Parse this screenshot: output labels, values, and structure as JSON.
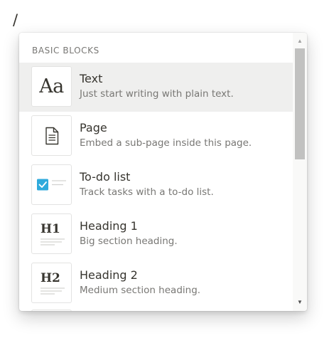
{
  "input": {
    "text": "/"
  },
  "menu": {
    "section_header": "BASIC BLOCKS",
    "items": [
      {
        "icon": "text-icon",
        "thumb": "Aa",
        "title": "Text",
        "description": "Just start writing with plain text.",
        "selected": true
      },
      {
        "icon": "page-icon",
        "title": "Page",
        "description": "Embed a sub-page inside this page.",
        "selected": false
      },
      {
        "icon": "todo-checkbox-icon",
        "title": "To-do list",
        "description": "Track tasks with a to-do list.",
        "selected": false
      },
      {
        "icon": "heading-1-icon",
        "thumb": "H1",
        "title": "Heading 1",
        "description": "Big section heading.",
        "selected": false
      },
      {
        "icon": "heading-2-icon",
        "thumb": "H2",
        "title": "Heading 2",
        "description": "Medium section heading.",
        "selected": false
      }
    ]
  },
  "colors": {
    "text_primary": "#37352f",
    "text_secondary": "#787774",
    "selected_bg": "#efefee",
    "checkbox_blue": "#2eaadc"
  }
}
